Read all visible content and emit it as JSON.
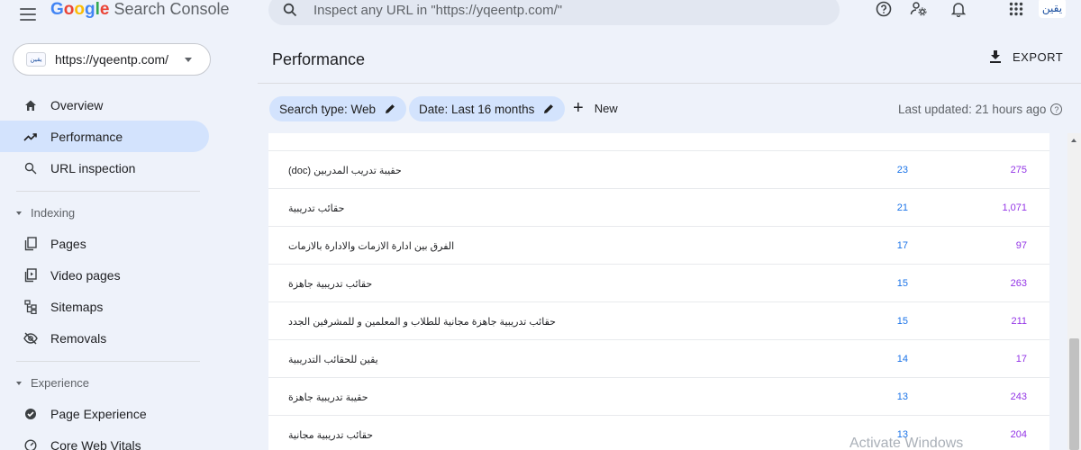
{
  "app": {
    "logo_google": "Google",
    "logo_product": "Search Console",
    "search_placeholder": "Inspect any URL in \"https://yqeentp.com/\"",
    "avatar_text": "يقين"
  },
  "property": {
    "url": "https://yqeentp.com/",
    "favicon_text": "يقين"
  },
  "sidebar": {
    "items": [
      {
        "label": "Overview",
        "icon": "home-icon"
      },
      {
        "label": "Performance",
        "icon": "trending-up-icon"
      },
      {
        "label": "URL inspection",
        "icon": "search-icon"
      }
    ],
    "indexing": {
      "title": "Indexing",
      "items": [
        {
          "label": "Pages",
          "icon": "pages-icon"
        },
        {
          "label": "Video pages",
          "icon": "video-pages-icon"
        },
        {
          "label": "Sitemaps",
          "icon": "sitemap-icon"
        },
        {
          "label": "Removals",
          "icon": "removals-icon"
        }
      ]
    },
    "experience": {
      "title": "Experience",
      "items": [
        {
          "label": "Page Experience",
          "icon": "page-experience-icon"
        },
        {
          "label": "Core Web Vitals",
          "icon": "gauge-icon"
        }
      ]
    }
  },
  "main": {
    "title": "Performance",
    "export_label": "EXPORT",
    "filters": [
      {
        "label": "Search type: Web"
      },
      {
        "label": "Date: Last 16 months"
      }
    ],
    "new_label": "New",
    "last_updated": "Last updated: 21 hours ago"
  },
  "table": {
    "rows": [
      {
        "query": "حقيبة تدريب المدربين (doc)",
        "clicks": "23",
        "impressions": "275"
      },
      {
        "query": "حقائب تدريبية",
        "clicks": "21",
        "impressions": "1,071"
      },
      {
        "query": "الفرق بين ادارة الازمات والادارة بالازمات",
        "clicks": "17",
        "impressions": "97"
      },
      {
        "query": "حقائب تدريبية جاهزة",
        "clicks": "15",
        "impressions": "263"
      },
      {
        "query": "حقائب تدريبية جاهزة مجانية للطلاب و المعلمين و للمشرفين الجدد",
        "clicks": "15",
        "impressions": "211"
      },
      {
        "query": "يقين للحقائب التدريبية",
        "clicks": "14",
        "impressions": "17"
      },
      {
        "query": "حقيبة تدريبية جاهزة",
        "clicks": "13",
        "impressions": "243"
      },
      {
        "query": "حقائب تدريبية مجانية",
        "clicks": "13",
        "impressions": "204"
      }
    ]
  },
  "colors": {
    "background": "#eef2fa",
    "active_nav": "#d3e3fd",
    "clicks": "#1a73e8",
    "impressions": "#9334e6"
  },
  "watermark": "Activate Windows"
}
